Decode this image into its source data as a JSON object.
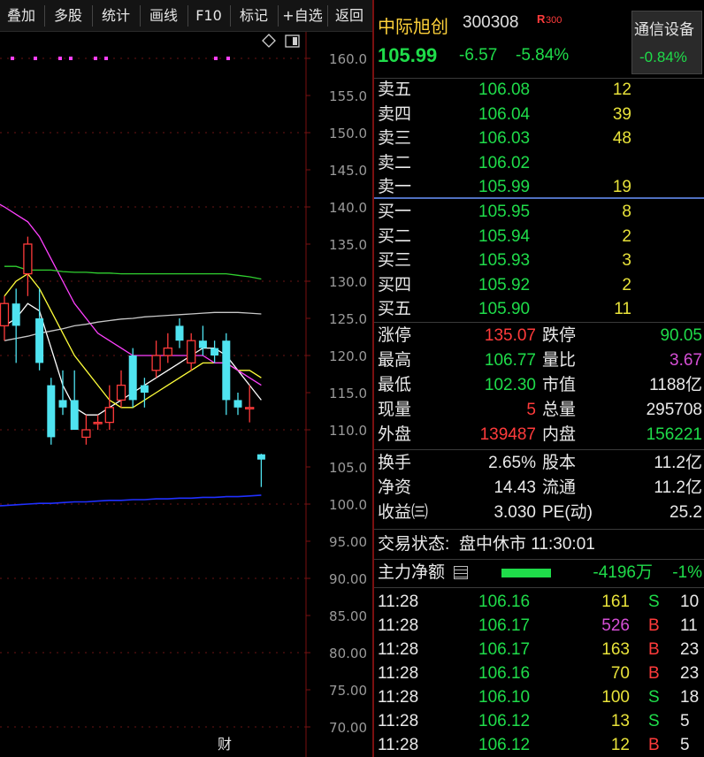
{
  "toolbar": {
    "buttons": [
      "叠加",
      "多股",
      "统计",
      "画线",
      "F10",
      "标记",
      "+自选",
      "返回"
    ]
  },
  "chart": {
    "y_ticks": [
      "160.0",
      "155.0",
      "150.0",
      "145.0",
      "140.0",
      "135.0",
      "130.0",
      "125.0",
      "120.0",
      "115.0",
      "110.0",
      "105.0",
      "100.0",
      "95.00",
      "90.00",
      "85.00",
      "80.00",
      "75.00",
      "70.00"
    ],
    "ylim": [
      70,
      160
    ],
    "marker_label": "财",
    "colors": {
      "up": "#ff3b3b",
      "down": "#4fe3f0",
      "ma5": "#ffffff",
      "ma10": "#ffff3a",
      "ma20": "#ff40ff",
      "ma60": "#30d030",
      "ma120": "#c8c8c8",
      "ma250": "#2030ff"
    }
  },
  "chart_data": {
    "type": "candlestick",
    "candles": [
      {
        "open": 124,
        "high": 128,
        "low": 122,
        "close": 127
      },
      {
        "open": 127,
        "high": 129,
        "low": 119,
        "close": 124
      },
      {
        "open": 131,
        "high": 136,
        "low": 128,
        "close": 135
      },
      {
        "open": 125,
        "high": 129,
        "low": 118,
        "close": 119
      },
      {
        "open": 116,
        "high": 117,
        "low": 108,
        "close": 109
      },
      {
        "open": 114,
        "high": 118,
        "low": 112,
        "close": 113
      },
      {
        "open": 114,
        "high": 118,
        "low": 110,
        "close": 110
      },
      {
        "open": 109,
        "high": 112,
        "low": 108,
        "close": 110
      },
      {
        "open": 111,
        "high": 112,
        "low": 110,
        "close": 111
      },
      {
        "open": 111,
        "high": 116,
        "low": 110,
        "close": 113
      },
      {
        "open": 114,
        "high": 118,
        "low": 113,
        "close": 116
      },
      {
        "open": 120,
        "high": 121,
        "low": 113,
        "close": 114
      },
      {
        "open": 116,
        "high": 117,
        "low": 113,
        "close": 115
      },
      {
        "open": 118,
        "high": 122,
        "low": 117,
        "close": 120
      },
      {
        "open": 120,
        "high": 123,
        "low": 119,
        "close": 121
      },
      {
        "open": 124,
        "high": 125,
        "low": 121,
        "close": 122
      },
      {
        "open": 119,
        "high": 123,
        "low": 118,
        "close": 122
      },
      {
        "open": 122,
        "high": 124,
        "low": 120,
        "close": 121
      },
      {
        "open": 121,
        "high": 122,
        "low": 119,
        "close": 120
      },
      {
        "open": 122,
        "high": 123,
        "low": 112,
        "close": 114
      },
      {
        "open": 114,
        "high": 115,
        "low": 112,
        "close": 113
      },
      {
        "open": 113,
        "high": 116,
        "low": 111,
        "close": 113
      },
      {
        "open": 106.7,
        "high": 106.77,
        "low": 102.3,
        "close": 105.99
      }
    ],
    "ma_lines": [
      {
        "name": "ma5",
        "values": [
          124,
          125,
          127,
          126,
          121,
          116,
          113,
          112,
          112,
          113,
          114,
          115,
          116,
          117,
          118,
          119,
          120,
          121,
          121,
          120,
          118,
          116,
          114
        ]
      },
      {
        "name": "ma10",
        "values": [
          128,
          130,
          131,
          129,
          126,
          123,
          120,
          118,
          116,
          114,
          113,
          113,
          114,
          115,
          116,
          117,
          118,
          119,
          119,
          119,
          118,
          118,
          117
        ]
      },
      {
        "name": "ma20",
        "values": [
          140,
          139,
          138,
          136,
          133,
          130,
          127,
          125,
          123,
          122,
          121,
          120,
          120,
          120,
          120,
          120,
          120,
          120,
          119,
          119,
          118,
          117,
          116
        ]
      },
      {
        "name": "ma60",
        "values": [
          132,
          132,
          131.5,
          131.5,
          131.5,
          131.3,
          131.2,
          131.2,
          131.1,
          131.1,
          131,
          131,
          131,
          131,
          131,
          131,
          131,
          131,
          131,
          131,
          130.8,
          130.6,
          130.3
        ]
      },
      {
        "name": "ma120",
        "values": [
          122,
          122.3,
          122.6,
          123,
          123.3,
          123.6,
          124,
          124.2,
          124.5,
          124.7,
          124.9,
          125,
          125.2,
          125.3,
          125.4,
          125.5,
          125.6,
          125.7,
          125.8,
          125.8,
          125.8,
          125.7,
          125.6
        ]
      },
      {
        "name": "ma250",
        "values": [
          99.8,
          99.9,
          100,
          100.1,
          100.1,
          100.2,
          100.3,
          100.3,
          100.4,
          100.5,
          100.5,
          100.6,
          100.6,
          100.7,
          100.7,
          100.8,
          100.8,
          100.9,
          100.9,
          101,
          101,
          101.1,
          101.2
        ]
      }
    ]
  },
  "quote": {
    "name": "中际旭创",
    "code": "300308",
    "badge": "R",
    "badge_sub": "300",
    "price": "105.99",
    "change": "-6.57",
    "change_pct": "-5.84%",
    "industry": "通信设备",
    "industry_pct": "-0.84%"
  },
  "asks": [
    {
      "label": "卖五",
      "price": "106.08",
      "vol": "12"
    },
    {
      "label": "卖四",
      "price": "106.04",
      "vol": "39"
    },
    {
      "label": "卖三",
      "price": "106.03",
      "vol": "48"
    },
    {
      "label": "卖二",
      "price": "106.02",
      "vol": ""
    },
    {
      "label": "卖一",
      "price": "105.99",
      "vol": "19"
    }
  ],
  "bids": [
    {
      "label": "买一",
      "price": "105.95",
      "vol": "8"
    },
    {
      "label": "买二",
      "price": "105.94",
      "vol": "2"
    },
    {
      "label": "买三",
      "price": "105.93",
      "vol": "3"
    },
    {
      "label": "买四",
      "price": "105.92",
      "vol": "2"
    },
    {
      "label": "买五",
      "price": "105.90",
      "vol": "11"
    }
  ],
  "stats": {
    "limit_up_label": "涨停",
    "limit_up": "135.07",
    "limit_down_label": "跌停",
    "limit_down": "90.05",
    "high_label": "最高",
    "high": "106.77",
    "vol_ratio_label": "量比",
    "vol_ratio": "3.67",
    "low_label": "最低",
    "low": "102.30",
    "mkt_cap_label": "市值",
    "mkt_cap": "1188亿",
    "cur_vol_label": "现量",
    "cur_vol": "5",
    "total_vol_label": "总量",
    "total_vol": "295708",
    "outer_label": "外盘",
    "outer": "139487",
    "inner_label": "内盘",
    "inner": "156221"
  },
  "fin": {
    "turnover_label": "换手",
    "turnover": "2.65%",
    "shares_label": "股本",
    "shares": "11.2亿",
    "nav_label": "净资",
    "nav": "14.43",
    "float_label": "流通",
    "float": "11.2亿",
    "eps_label": "收益㈢",
    "eps": "3.030",
    "pe_label": "PE(动)",
    "pe": "25.2"
  },
  "status": {
    "label": "交易状态:",
    "value": "盘中休市 11:30:01"
  },
  "flow": {
    "label": "主力净额",
    "value": "-4196万",
    "pct": "-1%"
  },
  "ticks": [
    {
      "time": "11:28",
      "price": "106.16",
      "vol": "161",
      "side": "S",
      "n": "10"
    },
    {
      "time": "11:28",
      "price": "106.17",
      "vol": "526",
      "side": "B",
      "n": "11"
    },
    {
      "time": "11:28",
      "price": "106.17",
      "vol": "163",
      "side": "B",
      "n": "23"
    },
    {
      "time": "11:28",
      "price": "106.16",
      "vol": "70",
      "side": "B",
      "n": "23"
    },
    {
      "time": "11:28",
      "price": "106.10",
      "vol": "100",
      "side": "S",
      "n": "18"
    },
    {
      "time": "11:28",
      "price": "106.12",
      "vol": "13",
      "side": "S",
      "n": "5"
    },
    {
      "time": "11:28",
      "price": "106.12",
      "vol": "12",
      "side": "B",
      "n": "5"
    }
  ]
}
